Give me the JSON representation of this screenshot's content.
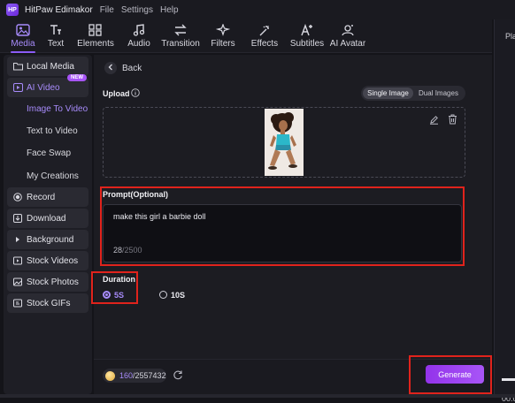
{
  "app": {
    "title": "HitPaw Edimakor",
    "logo_text": "HP",
    "menu": [
      "File",
      "Settings",
      "Help"
    ]
  },
  "toolbar": {
    "active": "Media",
    "items": [
      {
        "label": "Media",
        "icon": "media-icon"
      },
      {
        "label": "Text",
        "icon": "text-icon"
      },
      {
        "label": "Elements",
        "icon": "elements-icon"
      },
      {
        "label": "Audio",
        "icon": "audio-icon"
      },
      {
        "label": "Transition",
        "icon": "transition-icon"
      },
      {
        "label": "Filters",
        "icon": "filters-icon"
      },
      {
        "label": "Effects",
        "icon": "effects-icon"
      },
      {
        "label": "Subtitles",
        "icon": "subtitles-icon"
      },
      {
        "label": "AI Avatar",
        "icon": "ai-avatar-icon"
      }
    ]
  },
  "right_panel": {
    "label": "Pla",
    "time": "00:0"
  },
  "sidebar": {
    "items": [
      {
        "label": "Local Media",
        "type": "group",
        "icon": "folder-icon"
      },
      {
        "label": "AI Video",
        "type": "group",
        "icon": "ai-video-icon",
        "badge": "NEW",
        "active": true
      },
      {
        "label": "Image To Video",
        "type": "sub",
        "active": true
      },
      {
        "label": "Text to Video",
        "type": "sub"
      },
      {
        "label": "Face Swap",
        "type": "sub"
      },
      {
        "label": "My Creations",
        "type": "sub"
      },
      {
        "label": "Record",
        "type": "group",
        "icon": "record-icon"
      },
      {
        "label": "Download",
        "type": "group",
        "icon": "download-icon"
      },
      {
        "label": "Background",
        "type": "group",
        "icon": "triangle-right-icon"
      },
      {
        "label": "Stock Videos",
        "type": "group",
        "icon": "stock-videos-icon"
      },
      {
        "label": "Stock Photos",
        "type": "group",
        "icon": "stock-photos-icon"
      },
      {
        "label": "Stock GIFs",
        "type": "group",
        "icon": "stock-gifs-icon"
      }
    ]
  },
  "main": {
    "back_label": "Back",
    "upload_label": "Upload",
    "modes": [
      "Single Image",
      "Dual Images"
    ],
    "selected_mode": "Single Image",
    "prompt_label": "Prompt(Optional)",
    "prompt_value": "make this girl a barbie doll",
    "prompt_count": "28",
    "prompt_max": "/2500",
    "duration_label": "Duration",
    "durations": [
      "5S",
      "10S"
    ],
    "selected_duration": "5S"
  },
  "footer": {
    "credits_used": "160",
    "credits_total": "/2557432",
    "generate_label": "Generate"
  },
  "colors": {
    "accent": "#a78bfa",
    "generate": "#a855f7",
    "highlight": "#e0231c",
    "background": "#141419"
  }
}
